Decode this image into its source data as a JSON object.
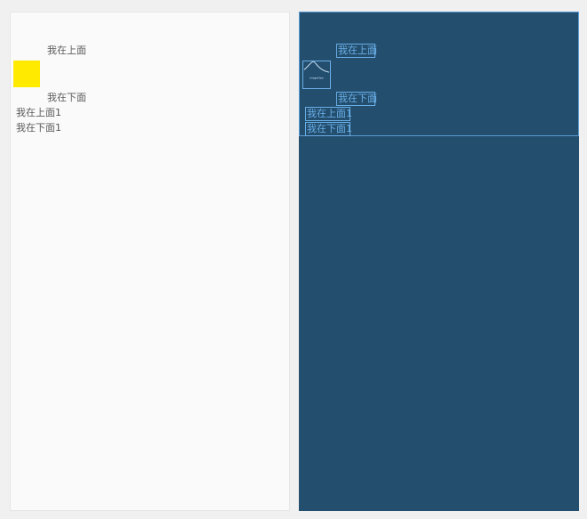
{
  "design": {
    "top_text": "我在上面",
    "bottom_text": "我在下面",
    "top_text_1": "我在上面1",
    "bottom_text_1": "我在下面1"
  },
  "blueprint": {
    "top_text": "我在上面",
    "bottom_text": "我在下面",
    "top_text_1": "我在上面1",
    "bottom_text_1": "我在下面1",
    "image_label": "ImageView"
  },
  "colors": {
    "yellow_image": "#ffea00",
    "blueprint_bg": "#234e6e",
    "blueprint_line": "#6aaee6"
  }
}
